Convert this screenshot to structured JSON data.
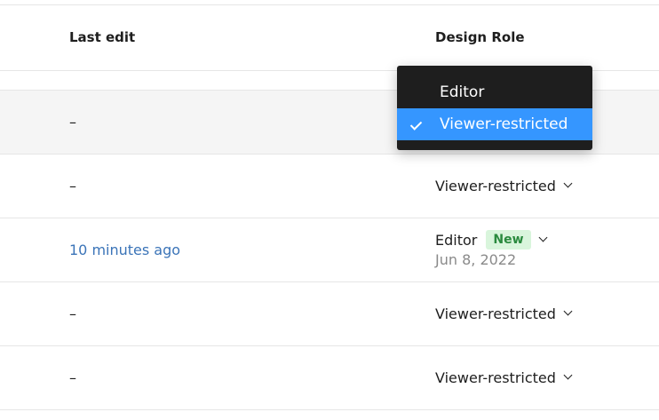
{
  "table": {
    "headers": {
      "last_edit": "Last edit",
      "design_role": "Design Role"
    },
    "rows": [
      {
        "last_edit": "–",
        "design_role": ""
      },
      {
        "last_edit": "–",
        "design_role": "Viewer-restricted"
      },
      {
        "last_edit": "10 minutes ago",
        "design_role": "Editor",
        "badge": "New",
        "date": "Jun 8, 2022"
      },
      {
        "last_edit": "–",
        "design_role": "Viewer-restricted"
      },
      {
        "last_edit": "–",
        "design_role": "Viewer-restricted"
      }
    ]
  },
  "role_menu": {
    "options": [
      {
        "label": "Editor",
        "selected": false
      },
      {
        "label": "Viewer-restricted",
        "selected": true
      }
    ]
  },
  "colors": {
    "menu_background": "#1e1e1e",
    "menu_selected": "#3596ff",
    "link": "#3b74b8",
    "badge_background": "#d9f5dc",
    "badge_text": "#2a8a3e"
  },
  "icons": {
    "dropdown_chevron": "chevron-down-icon",
    "selected_check": "check-icon"
  }
}
